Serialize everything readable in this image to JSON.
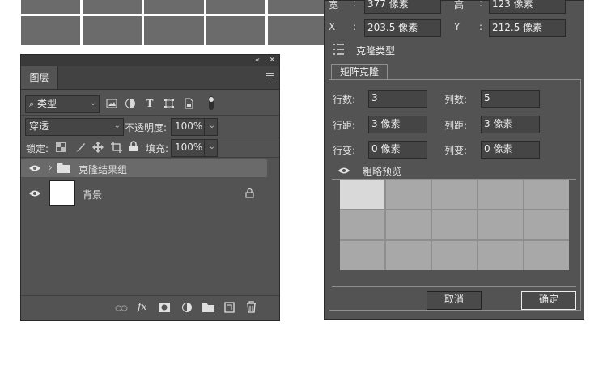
{
  "layers_panel": {
    "tab": "图层",
    "filter_kind": "类型",
    "blend_mode": "穿透",
    "opacity_label": "不透明度:",
    "opacity_value": "100%",
    "lock_label": "锁定:",
    "fill_label": "填充:",
    "fill_value": "100%",
    "layers": [
      {
        "name": "克隆结果组",
        "type": "group"
      },
      {
        "name": "背景",
        "type": "background"
      }
    ],
    "fx_label": "fx"
  },
  "dialog": {
    "width_label": "宽",
    "width_value": "377 像素",
    "height_label": "高",
    "height_value": "123 像素",
    "x_label": "X",
    "x_value": "203.5 像素",
    "y_label": "Y",
    "y_value": "212.5 像素",
    "section_title": "克隆类型",
    "tab": "矩阵克隆",
    "rows_label": "行数:",
    "rows_value": "3",
    "cols_label": "列数:",
    "cols_value": "5",
    "row_gap_label": "行距:",
    "row_gap_value": "3 像素",
    "col_gap_label": "列距:",
    "col_gap_value": "3 像素",
    "row_var_label": "行变:",
    "row_var_value": "0 像素",
    "col_var_label": "列变:",
    "col_var_value": "0 像素",
    "preview_label": "粗略预览",
    "cancel": "取消",
    "ok": "确定"
  },
  "colors": {
    "panel_bg": "#535353",
    "field_bg": "#454545",
    "preview_cell": "#a8a8a8",
    "preview_selected": "#d9d9d9"
  }
}
